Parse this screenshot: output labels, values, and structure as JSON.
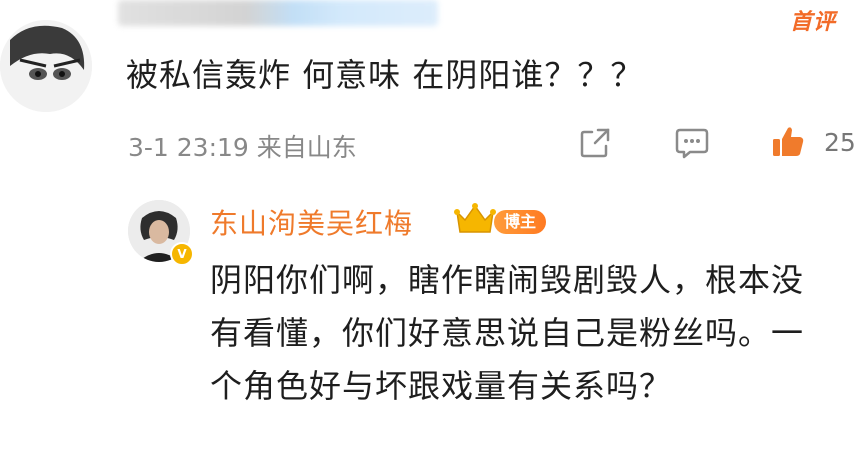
{
  "comment": {
    "author_badge": "首评",
    "text": "被私信轰炸  何意味  在阴阳谁？？？",
    "meta": "3-1 23:19  来自山东",
    "like_count": "25"
  },
  "reply": {
    "author_name": "东山洵美吴红梅",
    "badge": "博主",
    "verified_mark": "V",
    "text": "阴阳你们啊，瞎作瞎闹毁剧毁人，根本没有看懂，你们好意思说自己是粉丝吗。一个角色好与坏跟戏量有关系吗？"
  },
  "colors": {
    "accent": "#ef7a2b",
    "meta": "#888888",
    "text": "#1e1e1e"
  },
  "icons": [
    "share-icon",
    "comment-icon",
    "like-icon",
    "crown-icon"
  ]
}
